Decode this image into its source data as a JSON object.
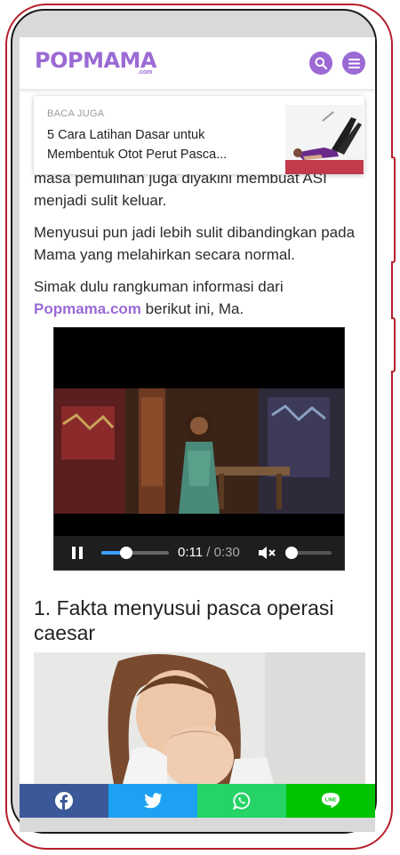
{
  "header": {
    "logo_text": "POPMAMA",
    "logo_sub": ".com",
    "brand_color": "#9b6ad4"
  },
  "related": {
    "tag": "BACA JUGA",
    "title": "5 Cara Latihan Dasar untuk Membentuk Otot Perut Pasca..."
  },
  "article": {
    "para_partial": "masa pemulihan juga diyakini membuat ASI menjadi sulit keluar.",
    "para_2": "Menyusui pun jadi lebih sulit dibandingkan pada Mama yang melahirkan secara normal.",
    "para_3_pre": "Simak dulu rangkuman informasi dari ",
    "para_3_link": "Popmama.com",
    "para_3_post": " berikut ini, Ma.",
    "heading": "1. Fakta menyusui pasca operasi caesar"
  },
  "video": {
    "current_time": "0:11",
    "separator": " / ",
    "duration": "0:30",
    "progress": 0.37,
    "volume": 0.0
  },
  "share": {
    "colors": {
      "facebook": "#3b5998",
      "twitter": "#1da1f2",
      "whatsapp": "#25d366",
      "line": "#00c300"
    }
  }
}
